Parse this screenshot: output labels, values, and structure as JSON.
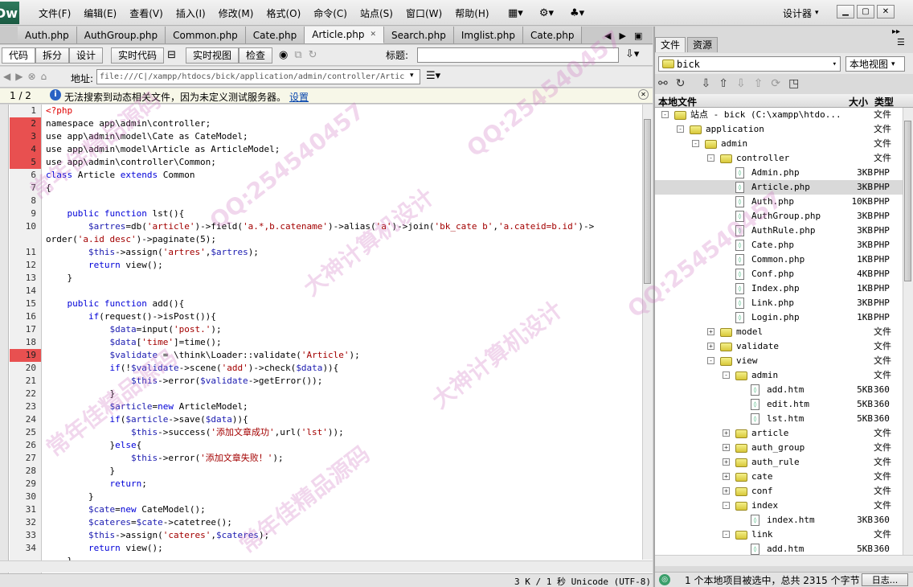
{
  "app": {
    "logo": "Dw"
  },
  "menu": [
    "文件(F)",
    "编辑(E)",
    "查看(V)",
    "插入(I)",
    "修改(M)",
    "格式(O)",
    "命令(C)",
    "站点(S)",
    "窗口(W)",
    "帮助(H)"
  ],
  "toolbar": {
    "layout_icon": "layout-icon",
    "gear_icon": "gear-icon",
    "extend_icon": "extend-icon",
    "designer_label": "设计器"
  },
  "tabs": [
    {
      "label": "Auth.php",
      "active": false
    },
    {
      "label": "AuthGroup.php",
      "active": false
    },
    {
      "label": "Common.php",
      "active": false
    },
    {
      "label": "Cate.php",
      "active": false
    },
    {
      "label": "Article.php",
      "active": true
    },
    {
      "label": "Search.php",
      "active": false
    },
    {
      "label": "Imglist.php",
      "active": false
    },
    {
      "label": "Cate.php",
      "active": false
    }
  ],
  "view": {
    "code": "代码",
    "split": "拆分",
    "design": "设计",
    "live_code": "实时代码",
    "live_view": "实时视图",
    "inspect": "检查",
    "title_label": "标题:"
  },
  "address": {
    "pager": "1 / 2",
    "label": "地址:",
    "value": "file:///C|/xampp/htdocs/bick/application/admin/controller/Artic"
  },
  "info": {
    "text": "无法搜索到动态相关文件，因为未定义测试服务器。",
    "link": "设置"
  },
  "code": {
    "lines": [
      {
        "n": "1",
        "err": false,
        "html": "<span class='ph'>&lt;?php</span>"
      },
      {
        "n": "2",
        "err": true,
        "html": "namespace app\\admin\\controller;"
      },
      {
        "n": "3",
        "err": true,
        "html": "use app\\admin\\model\\Cate as CateModel;"
      },
      {
        "n": "4",
        "err": true,
        "html": "use app\\admin\\model\\Article as ArticleModel;"
      },
      {
        "n": "5",
        "err": true,
        "html": "use app\\admin\\controller\\Common;"
      },
      {
        "n": "6",
        "err": false,
        "html": "<span class='kw'>class</span> Article <span class='kw'>extends</span> Common"
      },
      {
        "n": "7",
        "err": false,
        "html": "{"
      },
      {
        "n": "8",
        "err": false,
        "html": ""
      },
      {
        "n": "9",
        "err": false,
        "html": "    <span class='kw'>public function</span> lst(){"
      },
      {
        "n": "10",
        "err": false,
        "html": "        <span class='vr'>$artres</span>=db(<span class='st'>'article'</span>)->field(<span class='st'>'a.*,b.catename'</span>)->alias(<span class='st'>'a'</span>)->join(<span class='st'>'bk_cate b'</span>,<span class='st'>'a.cateid=b.id'</span>)->"
      },
      {
        "n": "",
        "err": false,
        "html": "order(<span class='st'>'a.id desc'</span>)->paginate(5);"
      },
      {
        "n": "11",
        "err": false,
        "html": "        <span class='vr'>$this</span>->assign(<span class='st'>'artres'</span>,<span class='vr'>$artres</span>);"
      },
      {
        "n": "12",
        "err": false,
        "html": "        <span class='kw'>return</span> view();"
      },
      {
        "n": "13",
        "err": false,
        "html": "    }"
      },
      {
        "n": "14",
        "err": false,
        "html": ""
      },
      {
        "n": "15",
        "err": false,
        "html": "    <span class='kw'>public function</span> add(){"
      },
      {
        "n": "16",
        "err": false,
        "html": "        <span class='kw'>if</span>(request()->isPost()){"
      },
      {
        "n": "17",
        "err": false,
        "html": "            <span class='vr'>$data</span>=input(<span class='st'>'post.'</span>);"
      },
      {
        "n": "18",
        "err": false,
        "html": "            <span class='vr'>$data</span>[<span class='st'>'time'</span>]=time();"
      },
      {
        "n": "19",
        "err": true,
        "html": "            <span class='vr'>$validate</span> = \\think\\Loader::validate(<span class='st'>'Article'</span>);"
      },
      {
        "n": "20",
        "err": false,
        "html": "            <span class='kw'>if</span>(!<span class='vr'>$validate</span>->scene(<span class='st'>'add'</span>)->check(<span class='vr'>$data</span>)){"
      },
      {
        "n": "21",
        "err": false,
        "html": "                <span class='vr'>$this</span>->error(<span class='vr'>$validate</span>->getError());"
      },
      {
        "n": "22",
        "err": false,
        "html": "            }"
      },
      {
        "n": "23",
        "err": false,
        "html": "            <span class='vr'>$article</span>=<span class='kw'>new</span> ArticleModel;"
      },
      {
        "n": "24",
        "err": false,
        "html": "            <span class='kw'>if</span>(<span class='vr'>$article</span>->save(<span class='vr'>$data</span>)){"
      },
      {
        "n": "25",
        "err": false,
        "html": "                <span class='vr'>$this</span>->success(<span class='st'>'添加文章成功'</span>,url(<span class='st'>'lst'</span>));"
      },
      {
        "n": "26",
        "err": false,
        "html": "            }<span class='kw'>else</span>{"
      },
      {
        "n": "27",
        "err": false,
        "html": "                <span class='vr'>$this</span>->error(<span class='st'>'添加文章失败！'</span>);"
      },
      {
        "n": "28",
        "err": false,
        "html": "            }"
      },
      {
        "n": "29",
        "err": false,
        "html": "            <span class='kw'>return</span>;"
      },
      {
        "n": "30",
        "err": false,
        "html": "        }"
      },
      {
        "n": "31",
        "err": false,
        "html": "        <span class='vr'>$cate</span>=<span class='kw'>new</span> CateModel();"
      },
      {
        "n": "32",
        "err": false,
        "html": "        <span class='vr'>$cateres</span>=<span class='vr'>$cate</span>->catetree();"
      },
      {
        "n": "33",
        "err": false,
        "html": "        <span class='vr'>$this</span>->assign(<span class='st'>'cateres'</span>,<span class='vr'>$cateres</span>);"
      },
      {
        "n": "34",
        "err": false,
        "html": "        <span class='kw'>return</span> view();"
      },
      {
        "n": "",
        "err": false,
        "html": "    }"
      }
    ]
  },
  "status": {
    "text": "3 K / 1 秒  Unicode (UTF-8)"
  },
  "panel": {
    "tabs": [
      "文件",
      "资源"
    ],
    "site": "bick",
    "view_mode": "本地视图",
    "col_file": "本地文件",
    "col_size": "大小",
    "col_type": "类型",
    "tree": [
      {
        "indent": 0,
        "exp": "-",
        "kind": "folder",
        "name": "站点 - bick (C:\\xampp\\htdo...",
        "size": "",
        "type": "文件",
        "sel": false
      },
      {
        "indent": 1,
        "exp": "-",
        "kind": "folder",
        "name": "application",
        "size": "",
        "type": "文件",
        "sel": false
      },
      {
        "indent": 2,
        "exp": "-",
        "kind": "folder",
        "name": "admin",
        "size": "",
        "type": "文件",
        "sel": false
      },
      {
        "indent": 3,
        "exp": "-",
        "kind": "folder",
        "name": "controller",
        "size": "",
        "type": "文件",
        "sel": false
      },
      {
        "indent": 4,
        "exp": "",
        "kind": "file",
        "name": "Admin.php",
        "size": "3KB",
        "type": "PHP",
        "sel": false
      },
      {
        "indent": 4,
        "exp": "",
        "kind": "file",
        "name": "Article.php",
        "size": "3KB",
        "type": "PHP",
        "sel": true
      },
      {
        "indent": 4,
        "exp": "",
        "kind": "file",
        "name": "Auth.php",
        "size": "10KB",
        "type": "PHP",
        "sel": false
      },
      {
        "indent": 4,
        "exp": "",
        "kind": "file",
        "name": "AuthGroup.php",
        "size": "3KB",
        "type": "PHP",
        "sel": false
      },
      {
        "indent": 4,
        "exp": "",
        "kind": "file",
        "name": "AuthRule.php",
        "size": "3KB",
        "type": "PHP",
        "sel": false
      },
      {
        "indent": 4,
        "exp": "",
        "kind": "file",
        "name": "Cate.php",
        "size": "3KB",
        "type": "PHP",
        "sel": false
      },
      {
        "indent": 4,
        "exp": "",
        "kind": "file",
        "name": "Common.php",
        "size": "1KB",
        "type": "PHP",
        "sel": false
      },
      {
        "indent": 4,
        "exp": "",
        "kind": "file",
        "name": "Conf.php",
        "size": "4KB",
        "type": "PHP",
        "sel": false
      },
      {
        "indent": 4,
        "exp": "",
        "kind": "file",
        "name": "Index.php",
        "size": "1KB",
        "type": "PHP",
        "sel": false
      },
      {
        "indent": 4,
        "exp": "",
        "kind": "file",
        "name": "Link.php",
        "size": "3KB",
        "type": "PHP",
        "sel": false
      },
      {
        "indent": 4,
        "exp": "",
        "kind": "file",
        "name": "Login.php",
        "size": "1KB",
        "type": "PHP",
        "sel": false
      },
      {
        "indent": 3,
        "exp": "+",
        "kind": "folder",
        "name": "model",
        "size": "",
        "type": "文件",
        "sel": false
      },
      {
        "indent": 3,
        "exp": "+",
        "kind": "folder",
        "name": "validate",
        "size": "",
        "type": "文件",
        "sel": false
      },
      {
        "indent": 3,
        "exp": "-",
        "kind": "folder",
        "name": "view",
        "size": "",
        "type": "文件",
        "sel": false
      },
      {
        "indent": 4,
        "exp": "-",
        "kind": "folder",
        "name": "admin",
        "size": "",
        "type": "文件",
        "sel": false
      },
      {
        "indent": 5,
        "exp": "",
        "kind": "file",
        "name": "add.htm",
        "size": "5KB",
        "type": "360",
        "sel": false
      },
      {
        "indent": 5,
        "exp": "",
        "kind": "file",
        "name": "edit.htm",
        "size": "5KB",
        "type": "360",
        "sel": false
      },
      {
        "indent": 5,
        "exp": "",
        "kind": "file",
        "name": "lst.htm",
        "size": "5KB",
        "type": "360",
        "sel": false
      },
      {
        "indent": 4,
        "exp": "+",
        "kind": "folder",
        "name": "article",
        "size": "",
        "type": "文件",
        "sel": false
      },
      {
        "indent": 4,
        "exp": "+",
        "kind": "folder",
        "name": "auth_group",
        "size": "",
        "type": "文件",
        "sel": false
      },
      {
        "indent": 4,
        "exp": "+",
        "kind": "folder",
        "name": "auth_rule",
        "size": "",
        "type": "文件",
        "sel": false
      },
      {
        "indent": 4,
        "exp": "+",
        "kind": "folder",
        "name": "cate",
        "size": "",
        "type": "文件",
        "sel": false
      },
      {
        "indent": 4,
        "exp": "+",
        "kind": "folder",
        "name": "conf",
        "size": "",
        "type": "文件",
        "sel": false
      },
      {
        "indent": 4,
        "exp": "-",
        "kind": "folder",
        "name": "index",
        "size": "",
        "type": "文件",
        "sel": false
      },
      {
        "indent": 5,
        "exp": "",
        "kind": "file",
        "name": "index.htm",
        "size": "3KB",
        "type": "360",
        "sel": false
      },
      {
        "indent": 4,
        "exp": "-",
        "kind": "folder",
        "name": "link",
        "size": "",
        "type": "文件",
        "sel": false
      },
      {
        "indent": 5,
        "exp": "",
        "kind": "file",
        "name": "add.htm",
        "size": "5KB",
        "type": "360",
        "sel": false
      }
    ],
    "status": "1 个本地项目被选中，总共 2315 个字节",
    "log_button": "日志..."
  },
  "watermarks": [
    "常年佳精品源码",
    "QQ:254540457",
    "大神计算机设计",
    "QQ:254540457",
    "常年佳精品源码",
    "大神计算机设计",
    "QQ:254540457",
    "常年佳精品源码"
  ]
}
